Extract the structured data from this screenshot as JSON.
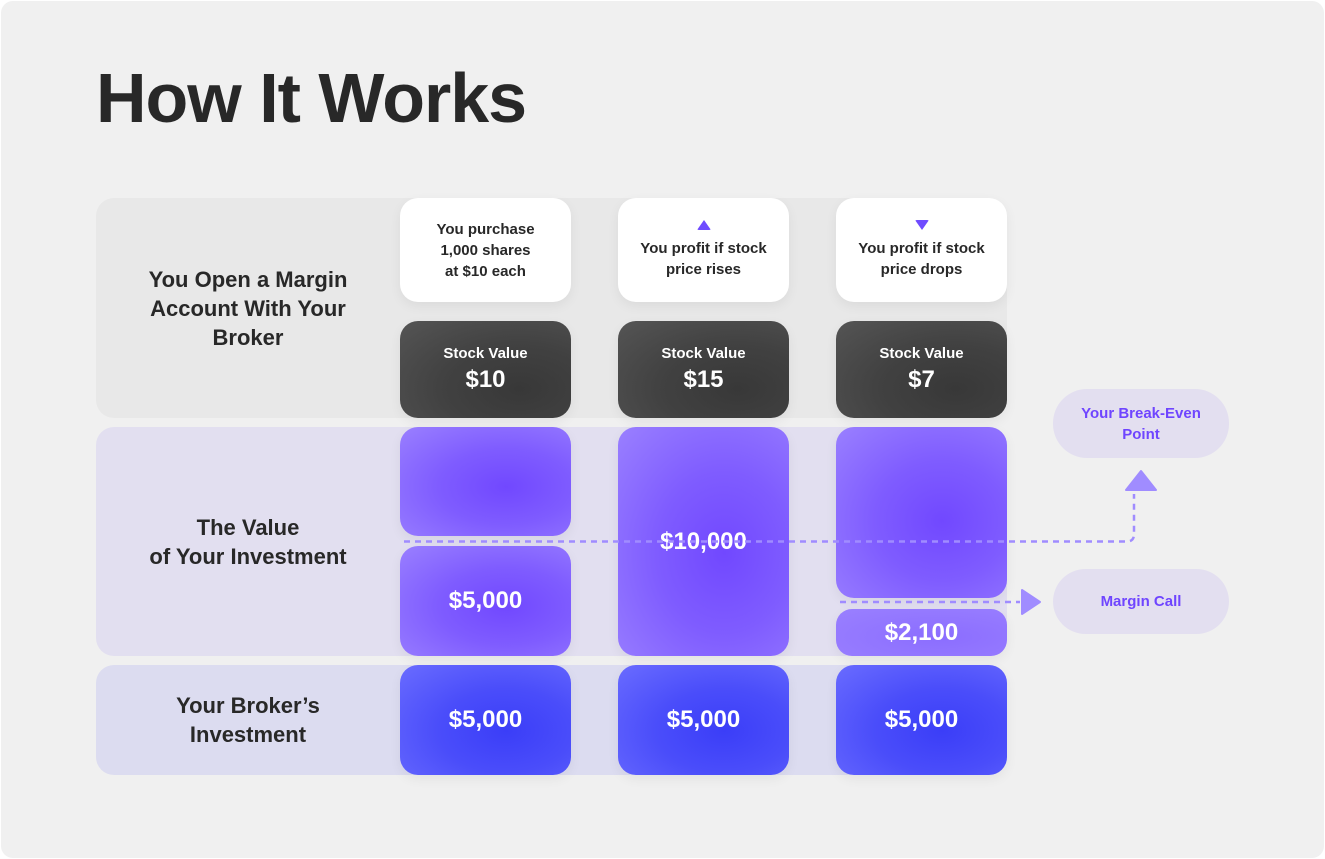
{
  "title": "How It Works",
  "rows": [
    {
      "label_lines": [
        "You Open a Margin",
        "Account With Your",
        "Broker"
      ]
    },
    {
      "label_lines": [
        "The Value",
        "of Your Investment"
      ]
    },
    {
      "label_lines": [
        "Your Broker’s",
        "Investment"
      ]
    }
  ],
  "scenarios": [
    {
      "description_lines": [
        "You purchase",
        "1,000 shares",
        "at $10 each"
      ],
      "indicator_icon": null,
      "stock_value_label": "Stock Value",
      "stock_value": "$10",
      "your_investment_top": "",
      "your_investment": "$5,000",
      "broker_investment": "$5,000"
    },
    {
      "description_lines": [
        "You profit if stock",
        "price rises"
      ],
      "indicator_icon": "triangle-up-icon",
      "stock_value_label": "Stock Value",
      "stock_value": "$15",
      "your_investment": "$10,000",
      "broker_investment": "$5,000"
    },
    {
      "description_lines": [
        "You profit if stock",
        "price drops"
      ],
      "indicator_icon": "triangle-down-icon",
      "stock_value_label": "Stock Value",
      "stock_value": "$7",
      "your_investment_top": "",
      "your_investment": "$2,100",
      "broker_investment": "$5,000"
    }
  ],
  "callouts": {
    "break_even_lines": [
      "Your Break-Even",
      "Point"
    ],
    "margin_call": "Margin Call"
  },
  "colors": {
    "accent": "#6f45ff",
    "purple_block": "#7f5cff",
    "blue_block": "#4a4dfa",
    "dark_block": "#414141",
    "dashed_line": "#a08cff"
  }
}
